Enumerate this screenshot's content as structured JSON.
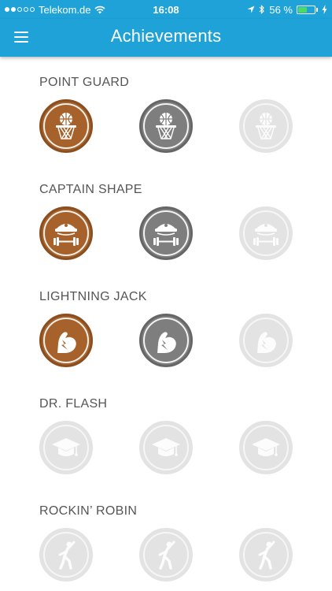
{
  "status_bar": {
    "carrier": "Telekom.de",
    "time": "16:08",
    "battery": "56 %",
    "battery_level": 0.56,
    "signal_bars": 2
  },
  "nav": {
    "title": "Achievements",
    "menu_icon": "hamburger-menu-icon"
  },
  "colors": {
    "header": "#1ea2d8",
    "bronze": "#a6622a",
    "silver": "#7e7e7e",
    "locked": "#e3e3e3"
  },
  "achievements": [
    {
      "title": "POINT GUARD",
      "icon": "basketball-hoop-icon",
      "levels": [
        "bronze",
        "silver",
        "locked"
      ]
    },
    {
      "title": "CAPTAIN SHAPE",
      "icon": "captain-dumbbell-icon",
      "levels": [
        "bronze",
        "silver",
        "locked"
      ]
    },
    {
      "title": "LIGHTNING JACK",
      "icon": "lightning-bicep-icon",
      "levels": [
        "bronze",
        "silver",
        "locked"
      ]
    },
    {
      "title": "DR. FLASH",
      "icon": "graduation-cap-icon",
      "levels": [
        "locked",
        "locked",
        "locked"
      ]
    },
    {
      "title": "ROCKIN’ ROBIN",
      "icon": "dancer-icon",
      "levels": [
        "locked",
        "locked",
        "locked"
      ]
    }
  ]
}
